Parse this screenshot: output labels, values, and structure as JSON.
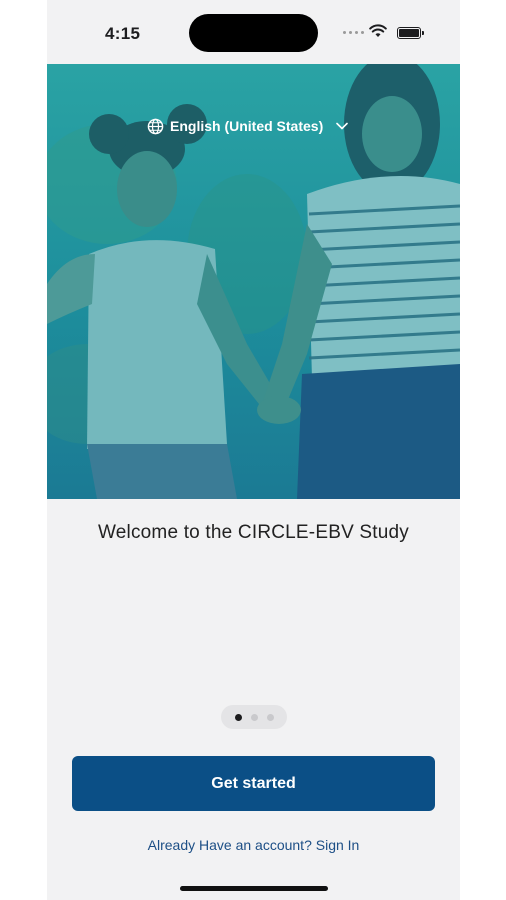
{
  "status_bar": {
    "time": "4:15"
  },
  "language_selector": {
    "label": "English (United States)",
    "globe_icon": "globe-icon",
    "chevron_icon": "chevron-down-icon"
  },
  "welcome": {
    "title": "Welcome to the CIRCLE-EBV Study"
  },
  "pager": {
    "total": 3,
    "active_index": 0
  },
  "actions": {
    "get_started": "Get started",
    "sign_in": "Already Have an account? Sign In"
  },
  "colors": {
    "hero_overlay": "#1d8e9c",
    "primary_button": "#0b4f86",
    "link": "#1d4f86",
    "background": "#f2f2f3"
  }
}
